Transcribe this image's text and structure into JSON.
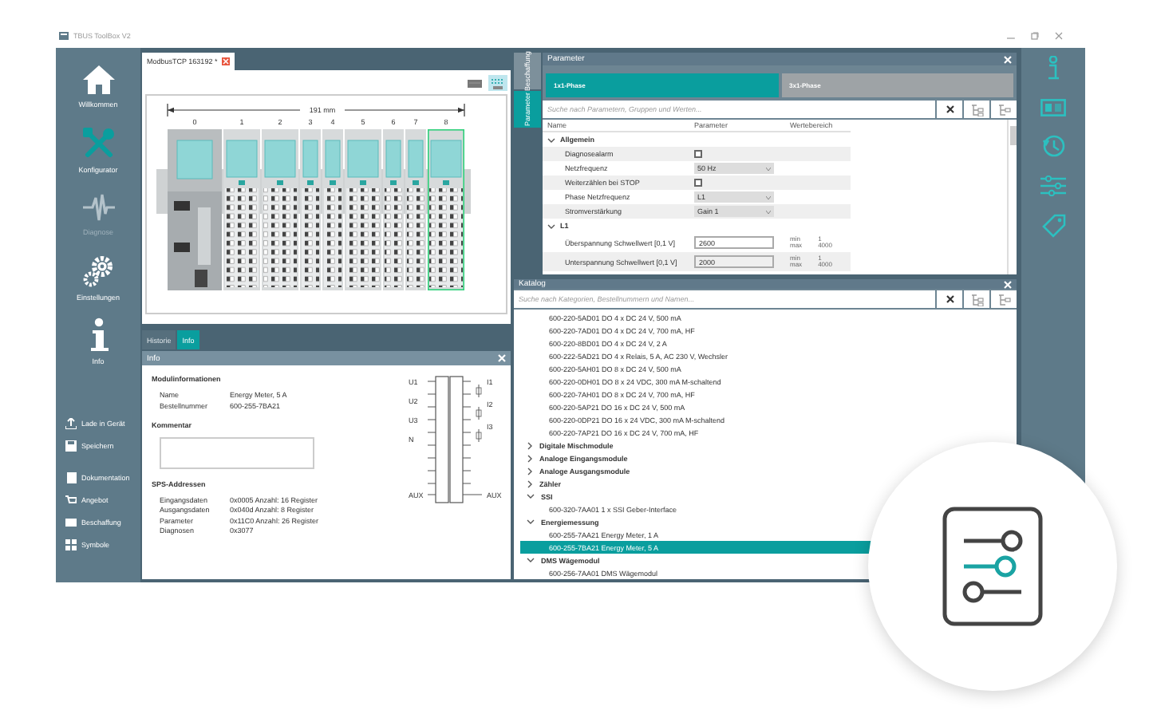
{
  "window": {
    "title": "TBUS ToolBox V2"
  },
  "nav": [
    {
      "label": "Willkommen",
      "selected": false,
      "disabled": false
    },
    {
      "label": "Konfigurator",
      "selected": true,
      "disabled": false
    },
    {
      "label": "Diagnose",
      "selected": false,
      "disabled": true
    },
    {
      "label": "Einstellungen",
      "selected": false,
      "disabled": false
    },
    {
      "label": "Info",
      "selected": false,
      "disabled": false
    }
  ],
  "device_actions": [
    {
      "label": "Lade in Gerät"
    },
    {
      "label": "Speichern"
    }
  ],
  "doc_actions": [
    {
      "label": "Dokumentation"
    },
    {
      "label": "Angebot"
    },
    {
      "label": "Beschaffung"
    },
    {
      "label": "Symbole"
    }
  ],
  "editor": {
    "tab": "ModbusTCP 163192 *",
    "dimension": "191 mm",
    "slots": [
      {
        "number": "0",
        "kind": "head",
        "selected": false
      },
      {
        "number": "1",
        "kind": "wide",
        "selected": false
      },
      {
        "number": "2",
        "kind": "wide",
        "selected": false
      },
      {
        "number": "3",
        "kind": "narrow",
        "selected": false
      },
      {
        "number": "4",
        "kind": "narrow",
        "selected": false
      },
      {
        "number": "5",
        "kind": "wide",
        "selected": false
      },
      {
        "number": "6",
        "kind": "narrow",
        "selected": false
      },
      {
        "number": "7",
        "kind": "narrow",
        "selected": false
      },
      {
        "number": "8",
        "kind": "wide",
        "selected": true
      }
    ]
  },
  "bottom_tabs": [
    {
      "label": "Historie",
      "selected": false
    },
    {
      "label": "Info",
      "selected": true
    }
  ],
  "info": {
    "title": "Info",
    "module_heading": "Modulinformationen",
    "module_rows": [
      {
        "label": "Name",
        "value": "Energy Meter, 5 A"
      },
      {
        "label": "Bestellnummer",
        "value": "600-255-7BA21"
      }
    ],
    "comment_heading": "Kommentar",
    "plc_heading": "SPS-Addressen",
    "plc_rows": [
      {
        "label": "Eingangsdaten",
        "value": "0x0005 Anzahl: 16 Register"
      },
      {
        "label": "Ausgangsdaten",
        "value": "0x040d Anzahl: 8 Register"
      },
      {
        "label": "Parameter",
        "value": "0x11C0 Anzahl: 26 Register"
      },
      {
        "label": "Diagnosen",
        "value": "0x3077"
      }
    ],
    "wiring": {
      "voltage_labels": [
        "U1",
        "U2",
        "U3",
        "N"
      ],
      "current_labels": [
        "I1",
        "I2",
        "I3"
      ],
      "aux_left": "AUX",
      "aux_right": "AUX"
    }
  },
  "parameter": {
    "side_tabs": [
      {
        "label": "Beschaffung",
        "selected": false
      },
      {
        "label": "Parameter",
        "selected": true
      }
    ],
    "title": "Parameter",
    "phase_tabs": [
      {
        "label": "1x1-Phase",
        "selected": true
      },
      {
        "label": "3x1-Phase",
        "selected": false
      }
    ],
    "search": {
      "placeholder": "Suche nach Parametern, Gruppen und Werten..."
    },
    "columns": [
      "Name",
      "Parameter",
      "Wertebereich"
    ],
    "groups": [
      {
        "label": "Allgemein",
        "expanded": true,
        "rows": [
          {
            "kind": "checkbox",
            "name": "Diagnosealarm",
            "checked": false
          },
          {
            "kind": "select",
            "name": "Netzfrequenz",
            "value": "50 Hz"
          },
          {
            "kind": "checkbox",
            "name": "Weiterzählen bei STOP",
            "checked": false
          },
          {
            "kind": "select",
            "name": "Phase Netzfrequenz",
            "value": "L1"
          },
          {
            "kind": "select",
            "name": "Stromverstärkung",
            "value": "Gain 1"
          }
        ]
      },
      {
        "label": "L1",
        "expanded": true,
        "rows": [
          {
            "kind": "number",
            "name": "Überspannung Schwellwert [0,1 V]",
            "value": "2600",
            "range_labels": [
              "min",
              "max"
            ],
            "range_values": [
              "1",
              "4000"
            ]
          },
          {
            "kind": "number",
            "name": "Unterspannung Schwellwert [0,1 V]",
            "value": "2000",
            "range_labels": [
              "min",
              "max"
            ],
            "range_values": [
              "1",
              "4000"
            ]
          }
        ]
      }
    ]
  },
  "catalog": {
    "title": "Katalog",
    "search": {
      "placeholder": "Suche nach Kategorien, Bestellnummern und Namen..."
    },
    "entries": [
      {
        "kind": "module",
        "label": "600-220-5AD01 DO 4 x DC 24 V, 500 mA",
        "selected": false
      },
      {
        "kind": "module",
        "label": "600-220-7AD01 DO 4 x DC 24 V, 700 mA, HF",
        "selected": false
      },
      {
        "kind": "module",
        "label": "600-220-8BD01 DO 4 x DC 24 V, 2 A",
        "selected": false
      },
      {
        "kind": "module",
        "label": "600-222-5AD21 DO 4 x Relais, 5 A, AC 230 V, Wechsler",
        "selected": false
      },
      {
        "kind": "module",
        "label": "600-220-5AH01 DO 8 x DC 24 V, 500 mA",
        "selected": false
      },
      {
        "kind": "module",
        "label": "600-220-0DH01 DO 8 x 24 VDC, 300 mA M-schaltend",
        "selected": false
      },
      {
        "kind": "module",
        "label": "600-220-7AH01 DO 8 x DC 24 V, 700 mA, HF",
        "selected": false
      },
      {
        "kind": "module",
        "label": "600-220-5AP21 DO 16 x DC 24 V, 500 mA",
        "selected": false
      },
      {
        "kind": "module",
        "label": "600-220-0DP21 DO 16 x 24 VDC, 300 mA M-schaltend",
        "selected": false
      },
      {
        "kind": "module",
        "label": "600-220-7AP21 DO 16 x DC 24 V, 700 mA, HF",
        "selected": false
      },
      {
        "kind": "category",
        "label": "Digitale Mischmodule",
        "expanded": false
      },
      {
        "kind": "category",
        "label": "Analoge Eingangsmodule",
        "expanded": false
      },
      {
        "kind": "category",
        "label": "Analoge Ausgangsmodule",
        "expanded": false
      },
      {
        "kind": "category",
        "label": "Zähler",
        "expanded": false
      },
      {
        "kind": "category",
        "label": "SSI",
        "expanded": true,
        "children": [
          {
            "label": "600-320-7AA01 1 x SSI Geber-Interface",
            "selected": false
          }
        ]
      },
      {
        "kind": "category",
        "label": "Energiemessung",
        "expanded": true,
        "children": [
          {
            "label": "600-255-7AA21 Energy Meter, 1 A",
            "selected": false
          },
          {
            "label": "600-255-7BA21 Energy Meter, 5 A",
            "selected": true
          }
        ]
      },
      {
        "kind": "category",
        "label": "DMS Wägemodul",
        "expanded": true,
        "children": [
          {
            "label": "600-256-7AA01 DMS Wägemodul",
            "selected": false
          }
        ]
      }
    ]
  }
}
